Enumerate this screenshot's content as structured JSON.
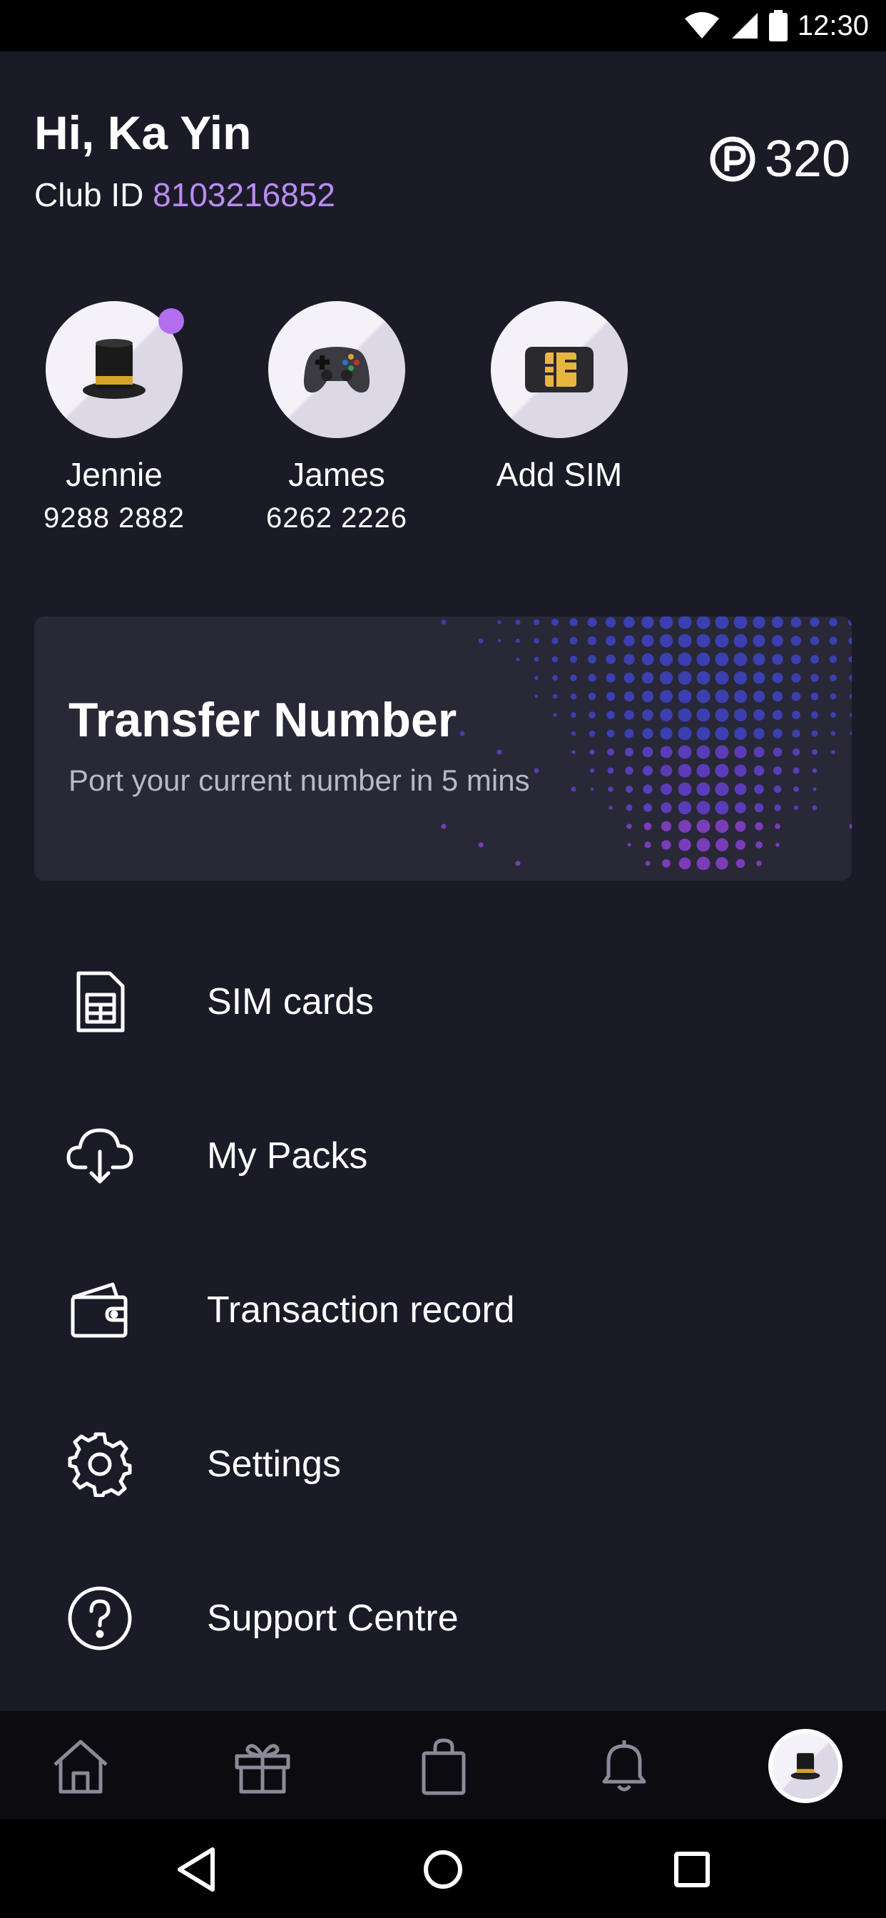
{
  "status_bar": {
    "time": "12:30"
  },
  "header": {
    "greeting": "Hi, Ka Yin",
    "club_id_label": "Club ID",
    "club_id_value": "8103216852",
    "points": "320"
  },
  "members": [
    {
      "name": "Jennie",
      "phone": "9288 2882",
      "icon": "top-hat-icon",
      "has_notification": true
    },
    {
      "name": "James",
      "phone": "6262 2226",
      "icon": "game-controller-icon",
      "has_notification": false
    },
    {
      "name": "Add SIM",
      "phone": "",
      "icon": "sim-card-icon",
      "has_notification": false
    }
  ],
  "transfer_card": {
    "title": "Transfer Number",
    "subtitle": "Port your current number in 5 mins"
  },
  "menu": [
    {
      "label": "SIM cards",
      "icon": "sim-card-icon"
    },
    {
      "label": "My Packs",
      "icon": "cloud-download-icon"
    },
    {
      "label": "Transaction record",
      "icon": "wallet-icon"
    },
    {
      "label": "Settings",
      "icon": "gear-icon"
    },
    {
      "label": "Support Centre",
      "icon": "question-circle-icon"
    }
  ],
  "bottom_nav": [
    "home-icon",
    "gift-icon",
    "shopping-bag-icon",
    "bell-icon",
    "profile-avatar"
  ],
  "colors": {
    "background": "#1b1b28",
    "accent": "#b88cf0",
    "card": "#282836",
    "nav": "#0b0b10"
  }
}
